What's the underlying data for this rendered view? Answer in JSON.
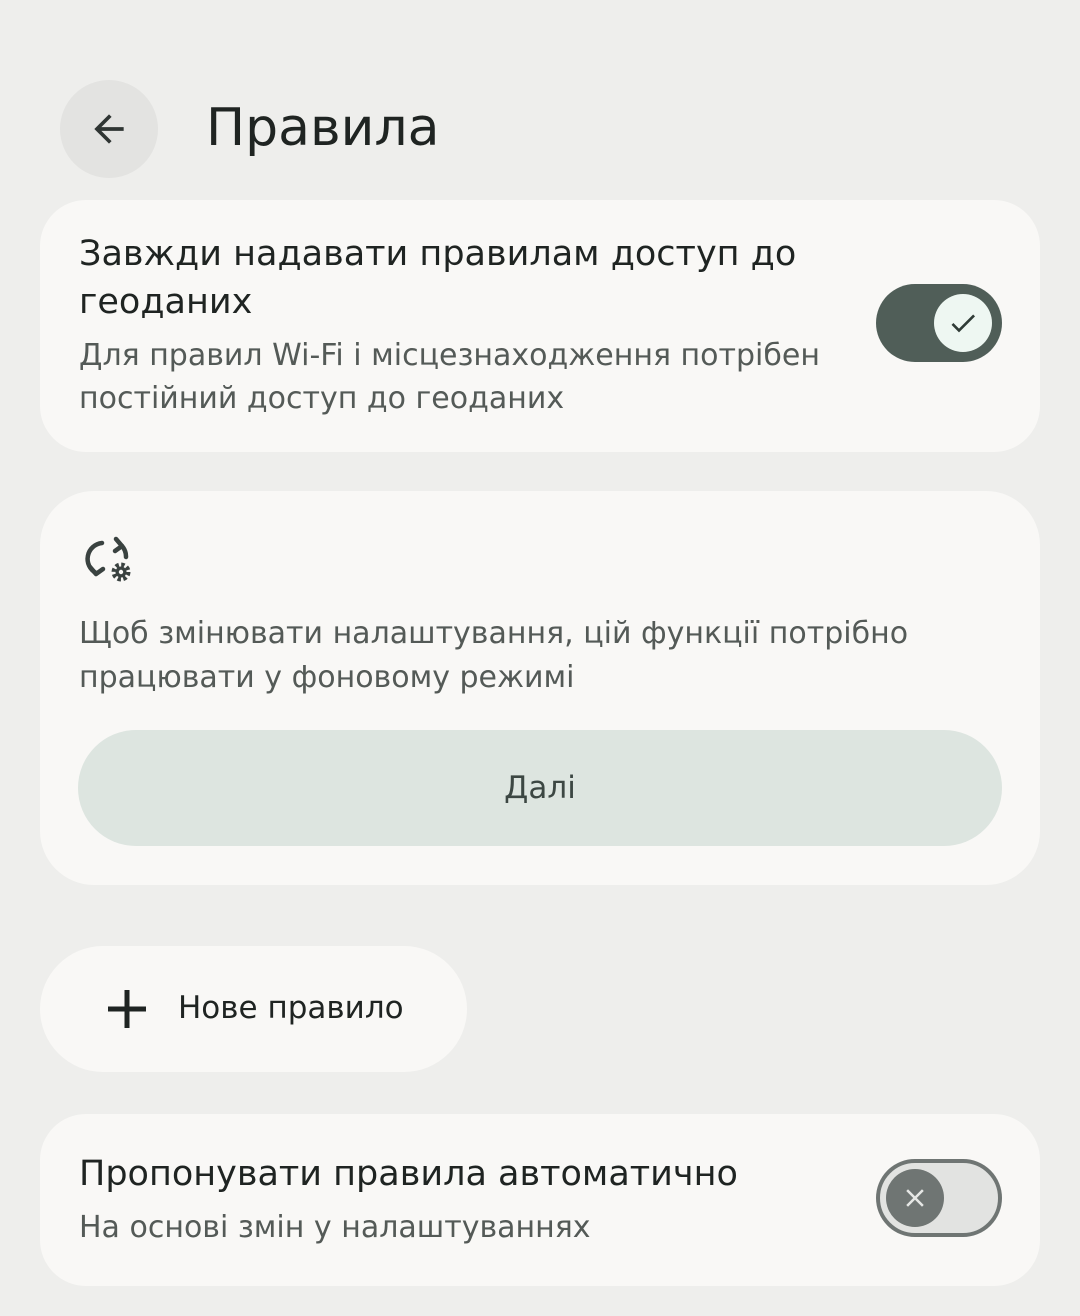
{
  "header": {
    "title": "Правила",
    "back_icon": "arrow-back-icon"
  },
  "geo_card": {
    "title": "Завжди надавати правилам доступ до геоданих",
    "subtitle": "Для правил Wi-Fi і місцезнаходження потрібен постійний доступ до геоданих",
    "toggle_state": "on",
    "toggle_icon": "check-icon",
    "toggle_track_color": "#505e58"
  },
  "background_card": {
    "icon": "sync-settings-icon",
    "message": "Щоб змінювати налаштування, цій функції потрібно працювати у фоновому режимі",
    "button_label": "Далі",
    "button_color": "#dde5e0"
  },
  "new_rule": {
    "icon": "plus-icon",
    "label": "Нове правило"
  },
  "suggest_card": {
    "title": "Пропонувати правила автоматично",
    "subtitle": "На основі змін у налаштуваннях",
    "toggle_state": "off",
    "toggle_icon": "close-icon"
  },
  "colors": {
    "background": "#eeeeec",
    "card": "#f9f8f6"
  }
}
